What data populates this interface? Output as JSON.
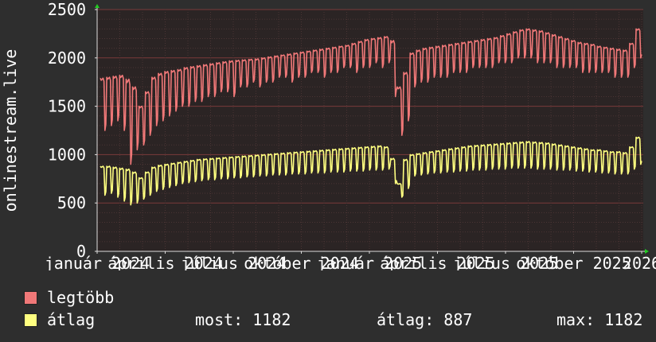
{
  "chart_data": {
    "type": "line",
    "ylabel": "onlinestream.live",
    "ylim": [
      0,
      2500
    ],
    "y_ticks": [
      0,
      500,
      1000,
      1500,
      2000,
      2500
    ],
    "x_tick_labels": [
      "január 2024",
      "április 2024",
      "július 2024",
      "október 2024",
      "január 2025",
      "április 2025",
      "július 2025",
      "október 2025",
      "2026"
    ],
    "grid": true,
    "series": [
      {
        "name": "legtöbb",
        "color": "#f07878",
        "weekly_high": [
          1790,
          1800,
          1810,
          1820,
          1780,
          1700,
          1500,
          1650,
          1800,
          1840,
          1860,
          1870,
          1880,
          1900,
          1910,
          1920,
          1930,
          1940,
          1950,
          1960,
          1970,
          1975,
          1980,
          1985,
          1990,
          2000,
          2010,
          2020,
          2030,
          2040,
          2050,
          2060,
          2070,
          2080,
          2090,
          2100,
          2110,
          2120,
          2130,
          2150,
          2170,
          2190,
          2200,
          2210,
          2220,
          2180,
          1700,
          1850,
          2050,
          2080,
          2100,
          2110,
          2120,
          2130,
          2140,
          2150,
          2160,
          2170,
          2180,
          2190,
          2200,
          2210,
          2230,
          2250,
          2270,
          2290,
          2300,
          2290,
          2280,
          2260,
          2240,
          2220,
          2200,
          2180,
          2160,
          2150,
          2140,
          2120,
          2110,
          2100,
          2090,
          2080,
          2150,
          2300
        ],
        "weekly_low": [
          1250,
          1300,
          1350,
          1250,
          900,
          1050,
          1100,
          1200,
          1300,
          1350,
          1400,
          1450,
          1500,
          1500,
          1550,
          1550,
          1600,
          1600,
          1650,
          1650,
          1600,
          1700,
          1700,
          1750,
          1700,
          1750,
          1750,
          1800,
          1800,
          1750,
          1800,
          1800,
          1850,
          1850,
          1800,
          1850,
          1850,
          1900,
          1900,
          1850,
          1900,
          1900,
          1950,
          1900,
          1950,
          1600,
          1200,
          1350,
          1700,
          1750,
          1750,
          1800,
          1800,
          1800,
          1850,
          1850,
          1850,
          1900,
          1900,
          1900,
          1900,
          1950,
          1950,
          1950,
          2000,
          2000,
          2000,
          1950,
          1950,
          1950,
          1900,
          1900,
          1900,
          1900,
          1850,
          1850,
          1850,
          1850,
          1850,
          1800,
          1800,
          1800,
          1900,
          2000
        ]
      },
      {
        "name": "átlag",
        "color": "#ffff80",
        "weekly_high": [
          880,
          880,
          870,
          860,
          850,
          820,
          760,
          820,
          870,
          890,
          900,
          910,
          920,
          930,
          940,
          950,
          955,
          960,
          965,
          970,
          975,
          980,
          985,
          990,
          995,
          1000,
          1005,
          1010,
          1015,
          1020,
          1025,
          1030,
          1035,
          1040,
          1045,
          1050,
          1055,
          1060,
          1065,
          1070,
          1075,
          1080,
          1085,
          1090,
          1080,
          960,
          700,
          950,
          1000,
          1010,
          1020,
          1030,
          1040,
          1050,
          1060,
          1070,
          1080,
          1090,
          1095,
          1100,
          1105,
          1110,
          1115,
          1120,
          1125,
          1130,
          1135,
          1130,
          1125,
          1120,
          1110,
          1100,
          1090,
          1080,
          1070,
          1060,
          1050,
          1050,
          1040,
          1030,
          1030,
          1020,
          1080,
          1180
        ],
        "weekly_low": [
          580,
          600,
          560,
          520,
          480,
          500,
          540,
          580,
          620,
          640,
          660,
          680,
          700,
          710,
          720,
          730,
          740,
          740,
          750,
          750,
          760,
          760,
          770,
          770,
          780,
          780,
          790,
          790,
          790,
          800,
          800,
          800,
          810,
          810,
          810,
          820,
          820,
          820,
          830,
          830,
          830,
          840,
          840,
          840,
          850,
          700,
          560,
          650,
          780,
          790,
          800,
          810,
          810,
          820,
          820,
          830,
          830,
          840,
          840,
          840,
          850,
          850,
          850,
          860,
          860,
          860,
          860,
          850,
          850,
          850,
          840,
          840,
          840,
          830,
          830,
          820,
          820,
          810,
          810,
          800,
          800,
          800,
          850,
          900
        ]
      }
    ]
  },
  "legend": [
    {
      "label": "legtöbb",
      "color": "#f07878"
    },
    {
      "label": "átlag",
      "color": "#ffff80",
      "most_label": "most:",
      "most_value": "1182",
      "avg_label": "átlag:",
      "avg_value": "887",
      "max_label": "max:",
      "max_value": "1182"
    }
  ]
}
